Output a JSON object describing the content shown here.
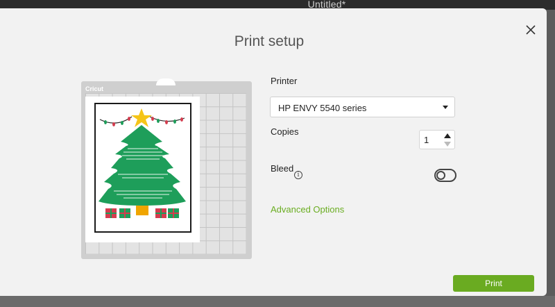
{
  "window": {
    "title": "Untitled*"
  },
  "dialog": {
    "title": "Print setup"
  },
  "mat": {
    "brand": "Cricut"
  },
  "printer": {
    "label": "Printer",
    "selected": "HP ENVY 5540 series"
  },
  "copies": {
    "label": "Copies",
    "value": "1"
  },
  "bleed": {
    "label": "Bleed",
    "info_glyph": "i",
    "enabled": false
  },
  "advanced_options": {
    "label": "Advanced Options"
  },
  "actions": {
    "print_label": "Print"
  },
  "colors": {
    "accent": "#6aab21",
    "tree": "#1e9e5a",
    "star": "#f5c518"
  },
  "icons": [
    "close-icon",
    "info-icon",
    "chevron-down-icon",
    "arrow-up-icon",
    "arrow-down-icon"
  ]
}
